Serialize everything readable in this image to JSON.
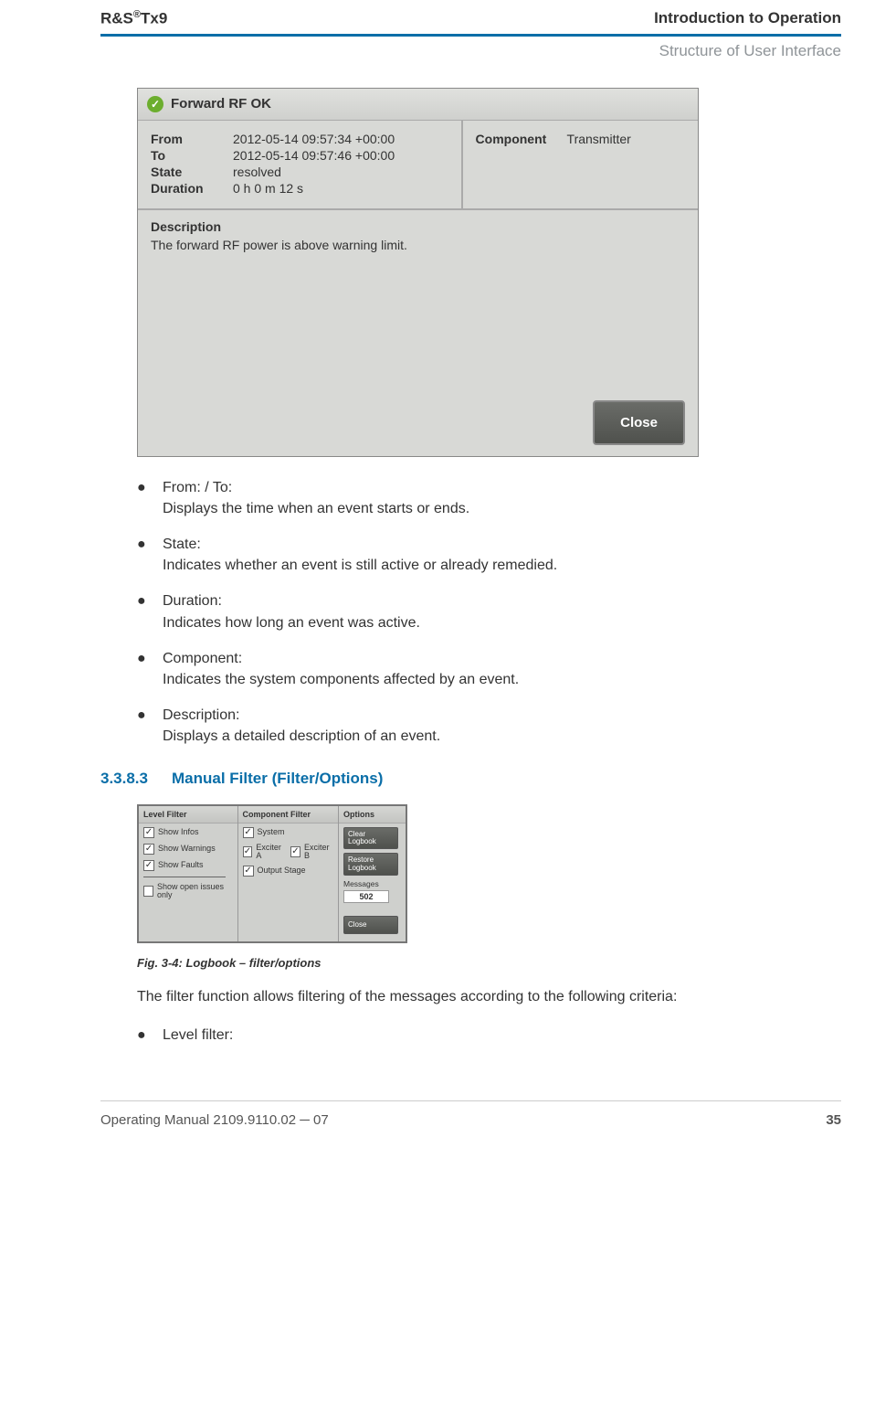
{
  "header": {
    "product": "R&S",
    "model": "Tx9",
    "right": "Introduction to Operation",
    "sub": "Structure of User Interface"
  },
  "dialog1": {
    "title": "Forward RF OK",
    "from_label": "From",
    "from_value": "2012-05-14 09:57:34 +00:00",
    "to_label": "To",
    "to_value": "2012-05-14 09:57:46 +00:00",
    "state_label": "State",
    "state_value": "resolved",
    "duration_label": "Duration",
    "duration_value": "0 h 0 m 12 s",
    "component_label": "Component",
    "component_value": "Transmitter",
    "desc_heading": "Description",
    "desc_text": "The forward RF power is above warning limit.",
    "close": "Close"
  },
  "bullets": [
    {
      "title": "From: / To:",
      "body": "Displays the time when an event starts or ends."
    },
    {
      "title": "State:",
      "body": "Indicates whether an event is still active or already remedied."
    },
    {
      "title": "Duration:",
      "body": "Indicates how long an event was active."
    },
    {
      "title": "Component:",
      "body": "Indicates the system components affected by an event."
    },
    {
      "title": "Description:",
      "body": "Displays a detailed description of an event."
    }
  ],
  "section": {
    "num": "3.3.8.3",
    "title": "Manual Filter (Filter/Options)"
  },
  "dialog2": {
    "level_title": "Level Filter",
    "component_title": "Component Filter",
    "options_title": "Options",
    "level_items": [
      "Show Infos",
      "Show Warnings",
      "Show Faults"
    ],
    "level_last": "Show open issues only",
    "comp_system": "System",
    "comp_exciter_a": "Exciter A",
    "comp_exciter_b": "Exciter B",
    "comp_output": "Output Stage",
    "btn_clear": "Clear Logbook",
    "btn_restore": "Restore Logbook",
    "msg_label": "Messages",
    "msg_value": "502",
    "btn_close": "Close"
  },
  "fig_caption": "Fig. 3-4: Logbook – filter/options",
  "para": "The filter function allows filtering of the messages according to the following criteria:",
  "bullet2": "Level filter:",
  "footer": {
    "left": "Operating Manual 2109.9110.02 ─ 07",
    "right": "35"
  }
}
